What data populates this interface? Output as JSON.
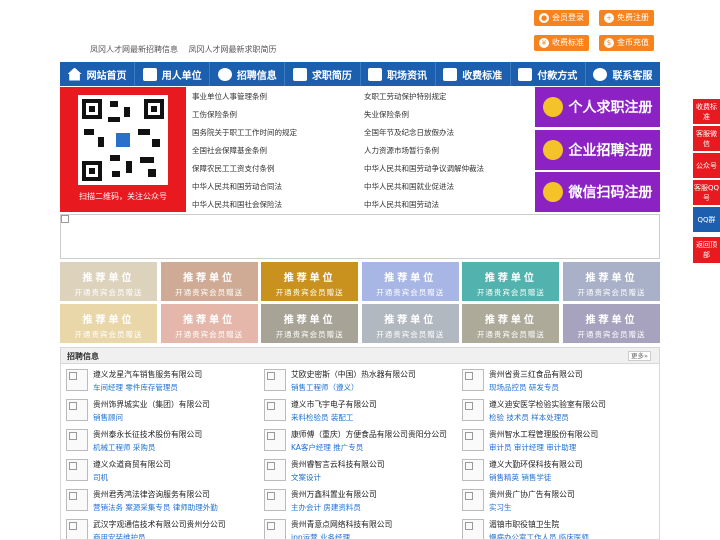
{
  "header": {
    "buttons": [
      {
        "label": "会员登录",
        "icon": "user-icon"
      },
      {
        "label": "免费注册",
        "icon": "register-icon"
      },
      {
        "label": "收费标准",
        "icon": "price-icon"
      },
      {
        "label": "金币充值",
        "icon": "coin-icon"
      }
    ],
    "latest_links": [
      "凤冈人才网最新招聘信息",
      "凤冈人才网最新求职简历"
    ]
  },
  "nav": [
    {
      "label": "网站首页",
      "icon": "home-icon"
    },
    {
      "label": "用人单位",
      "icon": "building-icon"
    },
    {
      "label": "招聘信息",
      "icon": "recruit-icon"
    },
    {
      "label": "求职简历",
      "icon": "resume-icon"
    },
    {
      "label": "职场资讯",
      "icon": "news-icon"
    },
    {
      "label": "收费标准",
      "icon": "fee-icon"
    },
    {
      "label": "付款方式",
      "icon": "payment-icon"
    },
    {
      "label": "联系客服",
      "icon": "service-icon"
    }
  ],
  "qr": {
    "caption": "扫描二维码，关注公众号"
  },
  "regulations": {
    "left": [
      "事业单位人事管理条例",
      "工伤保险条例",
      "国务院关于职工工作时间的规定",
      "全国社会保障基金条例",
      "保障农民工工资支付条例",
      "中华人民共和国劳动合同法",
      "中华人民共和国社会保险法"
    ],
    "right": [
      "女职工劳动保护特别规定",
      "失业保险条例",
      "全国年节及纪念日放假办法",
      "人力资源市场暂行条例",
      "中华人民共和国劳动争议调解仲裁法",
      "中华人民共和国就业促进法",
      "中华人民共和国劳动法"
    ]
  },
  "register": [
    {
      "label": "个人求职注册",
      "icon": "person-icon"
    },
    {
      "label": "企业招聘注册",
      "icon": "company-icon"
    },
    {
      "label": "微信扫码注册",
      "icon": "wechat-icon"
    }
  ],
  "recommend": {
    "title": "推荐单位",
    "subtitle": "开通贵宾会员赠送",
    "colors": [
      "#ddd3bd",
      "#cfab95",
      "#c9921e",
      "#a7b6e4",
      "#52b2ad",
      "#a9b1c9",
      "#ead7a9",
      "#e4b7aa",
      "#a7a396",
      "#b1b8bf",
      "#adaa99",
      "#a7a3bf"
    ]
  },
  "jobs": {
    "title": "招聘信息",
    "more": "更多»",
    "columns": [
      [
        {
          "company": "遵义龙星汽车销售服务有限公司",
          "positions": "车间经理 零件库存管理员"
        },
        {
          "company": "贵州饰界城实业（集团）有限公司",
          "positions": "销售顾问"
        },
        {
          "company": "贵州泰永长征技术股份有限公司",
          "positions": "机械工程师 采购员"
        },
        {
          "company": "遵义众道商贸有限公司",
          "positions": "司机"
        },
        {
          "company": "贵州君秀鸿法律咨询服务有限公司",
          "positions": "营销法务 案源采集专员 律师助理外勤"
        },
        {
          "company": "武汉字观通信技术有限公司贵州分公司",
          "positions": "商用安装维护员"
        }
      ],
      [
        {
          "company": "艾欧史密斯（中国）热水器有限公司",
          "positions": "销售工程师（遵义）"
        },
        {
          "company": "遵义市飞宇电子有限公司",
          "positions": "来料检验员 装配工"
        },
        {
          "company": "康师傅（重庆）方便食品有限公司贵阳分公司",
          "positions": "KA客户经理 推广专员"
        },
        {
          "company": "贵州睿智言云科技有限公司",
          "positions": "文案设计"
        },
        {
          "company": "贵州万鑫科置业有限公司",
          "positions": "主办会计 房建资料员"
        },
        {
          "company": "贵州青意点网络科技有限公司",
          "positions": "ipp运营 业务经理"
        }
      ],
      [
        {
          "company": "贵州省贵三红食品有限公司",
          "positions": "现场品控员 研发专员"
        },
        {
          "company": "遵义迪安医学检验实验室有限公司",
          "positions": "检验 技术员 样本处理员"
        },
        {
          "company": "贵州智水工程管理股份有限公司",
          "positions": "审计员 审计经理 审计助理"
        },
        {
          "company": "遵义大勤环保科技有限公司",
          "positions": "销售精英 销售学徒"
        },
        {
          "company": "贵州贵广协广告有限公司",
          "positions": "实习生"
        },
        {
          "company": "湄镇市职役镇卫生院",
          "positions": "慢病办公室工作人员 临床医师"
        }
      ]
    ]
  },
  "side_tools": [
    {
      "label": "收费标准",
      "color": "#e8191f"
    },
    {
      "label": "客服微信",
      "color": "#e8191f"
    },
    {
      "label": "公众号",
      "color": "#e8191f"
    },
    {
      "label": "客服QQ号",
      "color": "#e8191f"
    },
    {
      "label": "QQ群",
      "color": "#1b5fae"
    },
    {
      "label": "返回顶部",
      "color": "#e8191f"
    }
  ]
}
